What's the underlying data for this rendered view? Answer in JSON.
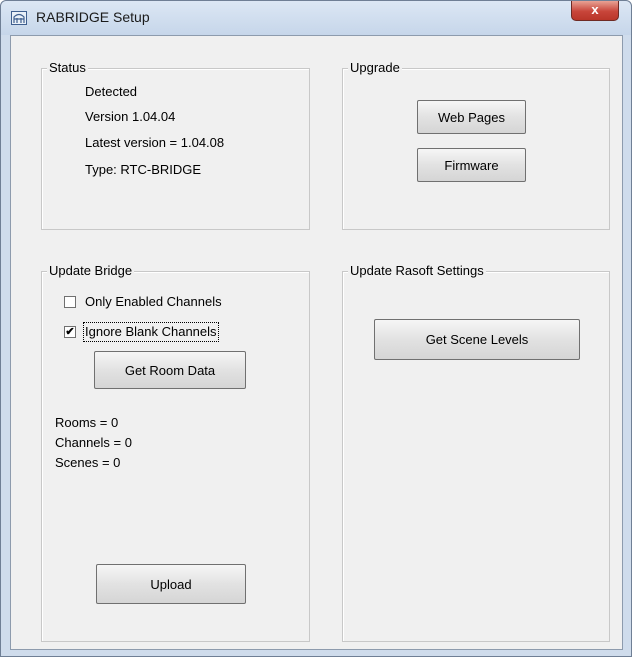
{
  "window": {
    "title": "RABRIDGE Setup",
    "close_glyph": "x",
    "icon": "app-icon"
  },
  "status": {
    "label": "Status",
    "lines": [
      "Detected",
      "Version  1.04.04",
      "Latest version =  1.04.08",
      "Type:  RTC-BRIDGE"
    ]
  },
  "upgrade": {
    "label": "Upgrade",
    "web_pages": "Web Pages",
    "firmware": "Firmware"
  },
  "update_bridge": {
    "label": "Update Bridge",
    "only_enabled": {
      "label": "Only Enabled Channels",
      "checked": false
    },
    "ignore_blank": {
      "label": "Ignore Blank Channels",
      "checked": true,
      "check_glyph": "✔"
    },
    "get_room_data": "Get Room Data",
    "counts": [
      "Rooms = 0",
      "Channels = 0",
      "Scenes = 0"
    ],
    "upload": "Upload"
  },
  "update_rasoft": {
    "label": "Update Rasoft Settings",
    "get_scene_levels": "Get Scene Levels"
  }
}
